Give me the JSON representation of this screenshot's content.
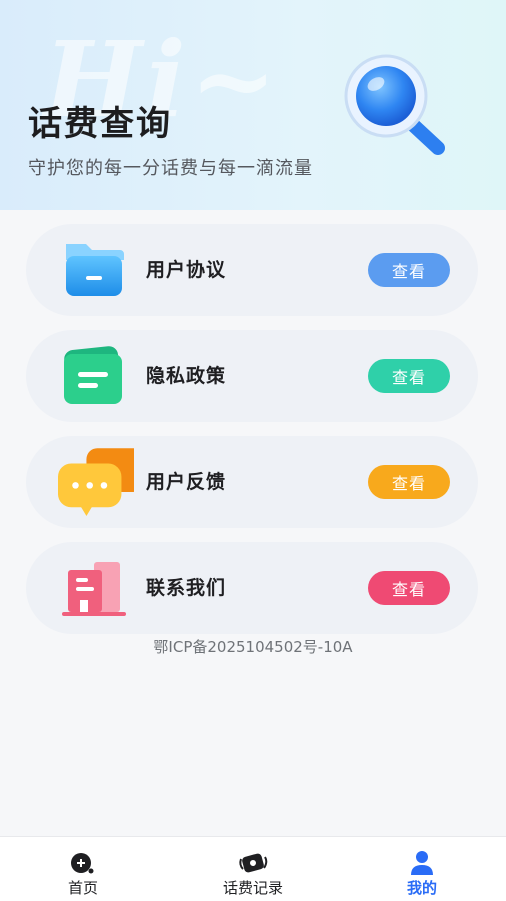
{
  "header": {
    "watermark": "Hi~",
    "title": "话费查询",
    "subtitle": "守护您的每一分话费与每一滴流量"
  },
  "cards": [
    {
      "label": "用户协议",
      "button": "查看",
      "icon": "folder-icon",
      "button_color": "#5b9cf0"
    },
    {
      "label": "隐私政策",
      "button": "查看",
      "icon": "document-icon",
      "button_color": "#2fd0a9"
    },
    {
      "label": "用户反馈",
      "button": "查看",
      "icon": "chat-bubble-icon",
      "button_color": "#f8a91c"
    },
    {
      "label": "联系我们",
      "button": "查看",
      "icon": "building-icon",
      "button_color": "#ef4a73"
    }
  ],
  "icp": "鄂ICP备2025104502号-10A",
  "tabbar": {
    "items": [
      {
        "label": "首页",
        "icon": "home-icon",
        "active": false
      },
      {
        "label": "话费记录",
        "icon": "records-icon",
        "active": false
      },
      {
        "label": "我的",
        "icon": "profile-icon",
        "active": true
      }
    ],
    "active_color": "#2a6cf6"
  }
}
